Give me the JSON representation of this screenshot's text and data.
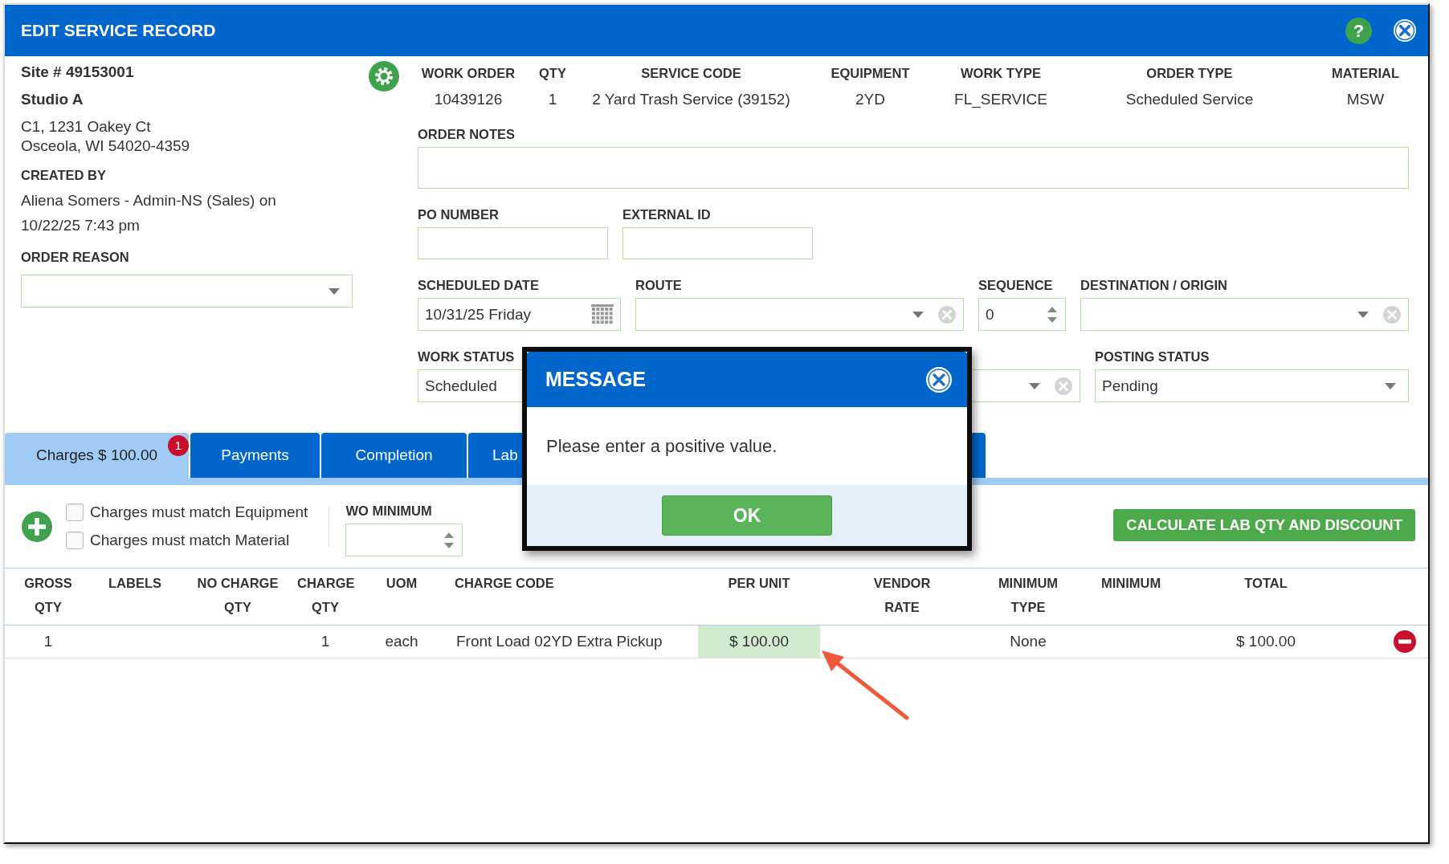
{
  "window": {
    "title": "EDIT SERVICE RECORD",
    "help": "?"
  },
  "site": {
    "number": "Site # 49153001",
    "name": "Studio A",
    "address": [
      "C1, 1231 Oakey Ct",
      "Osceola, WI 54020-4359"
    ],
    "created_by_label": "CREATED BY",
    "created_by": "Aliena Somers - Admin-NS (Sales) on 10/22/25 7:43 pm",
    "order_reason": {
      "label": "ORDER REASON",
      "kind": "select"
    }
  },
  "summary": [
    {
      "label": "WORK ORDER",
      "value": "10439126"
    },
    {
      "label": "QTY",
      "value": "1"
    },
    {
      "label": "SERVICE CODE",
      "value": "2 Yard Trash Service (39152)"
    },
    {
      "label": "EQUIPMENT",
      "value": "2YD"
    },
    {
      "label": "WORK TYPE",
      "value": "FL_SERVICE"
    },
    {
      "label": "ORDER TYPE",
      "value": "Scheduled Service"
    },
    {
      "label": "MATERIAL",
      "value": "MSW"
    }
  ],
  "form_rows": [
    [
      {
        "label": "ORDER NOTES",
        "kind": "textarea"
      }
    ],
    [
      {
        "label": "PO NUMBER",
        "kind": "text"
      },
      {
        "label": "EXTERNAL ID",
        "kind": "text"
      }
    ],
    [
      {
        "label": "SCHEDULED DATE",
        "kind": "date",
        "value": "10/31/25 Friday"
      },
      {
        "label": "ROUTE",
        "kind": "combo"
      },
      {
        "label": "SEQUENCE",
        "kind": "spinner",
        "value": "0"
      },
      {
        "label": "DESTINATION / ORIGIN",
        "kind": "combo"
      }
    ],
    [
      {
        "label": "WORK STATUS",
        "kind": "text",
        "value": "Scheduled"
      },
      {
        "kind": "combo"
      },
      {
        "label": "POSTING STATUS",
        "kind": "select",
        "value": "Pending"
      }
    ]
  ],
  "tabs": [
    {
      "label": "Charges $ 100.00",
      "selected": true,
      "badge": "1"
    },
    {
      "label": "Payments",
      "selected": false
    },
    {
      "label": "Completion",
      "selected": false
    },
    {
      "label": "Lab",
      "selected": false
    }
  ],
  "toolbar": {
    "checkboxes": [
      {
        "label": "Charges must match Equipment",
        "checked": false
      },
      {
        "label": "Charges must match Material",
        "checked": false
      }
    ],
    "wo_minimum": {
      "label": "WO MINIMUM"
    },
    "calculate_button": "CALCULATE LAB QTY AND DISCOUNT"
  },
  "table": {
    "columns": [
      "GROSS QTY",
      "LABELS",
      "NO CHARGE QTY",
      "CHARGE QTY",
      "UOM",
      "CHARGE CODE",
      "PER UNIT",
      "VENDOR RATE",
      "MINIMUM TYPE",
      "MINIMUM",
      "TOTAL"
    ],
    "rows": [
      {
        "gross_qty": "1",
        "charge_qty": "1",
        "uom": "each",
        "charge_code": "Front Load 02YD Extra Pickup",
        "per_unit": "$ 100.00",
        "per_unit_highlighted": true,
        "minimum_type": "None",
        "total": "$ 100.00"
      }
    ]
  },
  "dialog": {
    "title": "MESSAGE",
    "text": "Please enter a positive value.",
    "button": "OK"
  }
}
